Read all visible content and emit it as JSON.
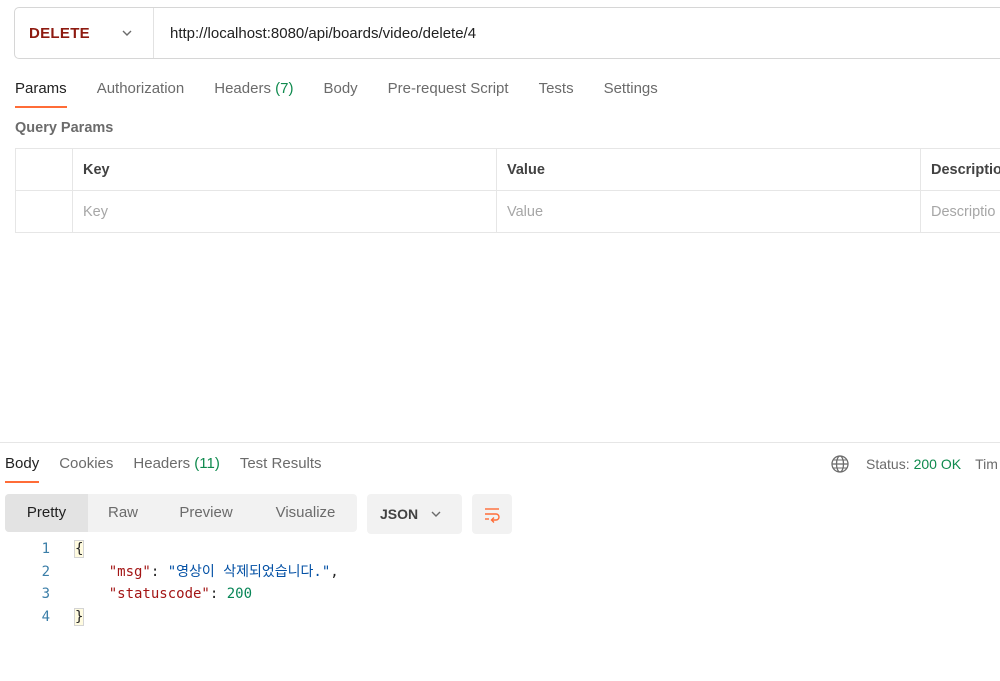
{
  "request": {
    "method": "DELETE",
    "url": "http://localhost:8080/api/boards/video/delete/4"
  },
  "request_tabs": [
    {
      "label": "Params",
      "count": ""
    },
    {
      "label": "Authorization",
      "count": ""
    },
    {
      "label": "Headers",
      "count": "(7)"
    },
    {
      "label": "Body",
      "count": ""
    },
    {
      "label": "Pre-request Script",
      "count": ""
    },
    {
      "label": "Tests",
      "count": ""
    },
    {
      "label": "Settings",
      "count": ""
    }
  ],
  "query_params": {
    "title": "Query Params",
    "headers": {
      "key": "Key",
      "value": "Value",
      "description": "Descriptio"
    },
    "placeholders": {
      "key": "Key",
      "value": "Value",
      "description": "Descriptio"
    }
  },
  "response_tabs": [
    {
      "label": "Body",
      "count": ""
    },
    {
      "label": "Cookies",
      "count": ""
    },
    {
      "label": "Headers",
      "count": "(11)"
    },
    {
      "label": "Test Results",
      "count": ""
    }
  ],
  "status": {
    "label": "Status:",
    "value": "200 OK",
    "time_label": "Tim"
  },
  "view_modes": [
    "Pretty",
    "Raw",
    "Preview",
    "Visualize"
  ],
  "format": "JSON",
  "code_lines": [
    {
      "n": "1",
      "open": "{"
    },
    {
      "n": "2",
      "key": "\"msg\"",
      "sep": ": ",
      "str": "\"영상이 삭제되었습니다.\"",
      "end": ","
    },
    {
      "n": "3",
      "key": "\"statuscode\"",
      "sep": ": ",
      "num": "200"
    },
    {
      "n": "4",
      "close": "}"
    }
  ],
  "colors": {
    "accent": "#ff6c37",
    "method": "#8e1a10",
    "success": "#0f8a4e"
  },
  "icons": [
    "chevron-down-icon",
    "globe-icon",
    "wrap-lines-icon"
  ]
}
